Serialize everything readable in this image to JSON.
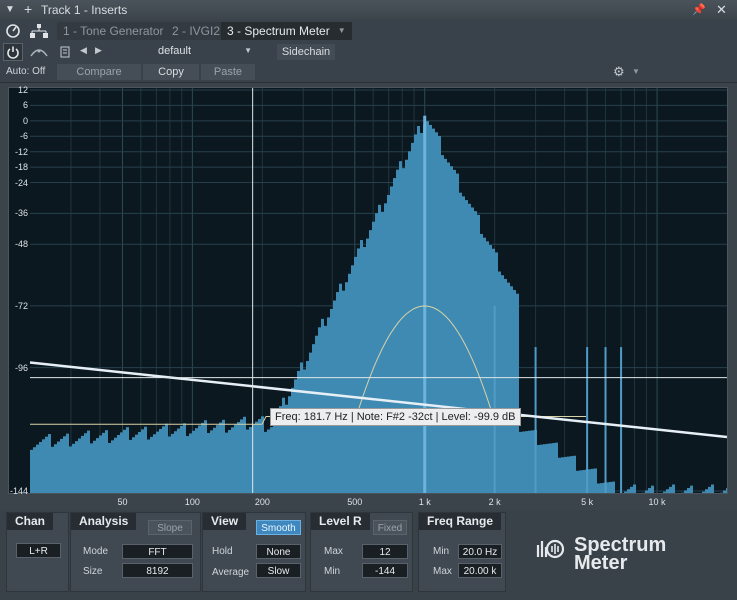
{
  "titlebar": {
    "title": "Track 1 - Inserts"
  },
  "tabs": [
    {
      "label": "1 - Tone Generator"
    },
    {
      "label": "2 - IVGI2"
    },
    {
      "label": "3 - Spectrum Meter"
    }
  ],
  "toolbar": {
    "auto_label": "Auto: Off",
    "preset": "default",
    "sidechain": "Sidechain",
    "compare": "Compare",
    "copy": "Copy",
    "paste": "Paste"
  },
  "tooltip": "Freq: 181.7 Hz | Note: F#2 -32ct | Level: -99.9 dB",
  "chart_data": {
    "type": "area",
    "x_scale": "log",
    "xlim": [
      20,
      20000
    ],
    "ylim": [
      -144,
      12
    ],
    "y_ticks": [
      "12",
      "6",
      "0",
      "-6",
      "-12",
      "-18",
      "-24",
      "-36",
      "-48",
      "-72",
      "-96",
      "-144"
    ],
    "x_ticks": [
      "50",
      "100",
      "200",
      "500",
      "1 k",
      "2 k",
      "5 k",
      "10 k"
    ],
    "cursor": {
      "freq_hz": 181.7,
      "level_db": -99.9
    },
    "slope_line": {
      "x": [
        20,
        20000
      ],
      "y": [
        -94,
        -123
      ]
    },
    "spectrum_peak_hz": 1000,
    "spectrum_peak_db": 2
  },
  "panel": {
    "chan": {
      "title": "Chan",
      "value": "L+R"
    },
    "analysis": {
      "title": "Analysis",
      "slope": "Slope",
      "mode_label": "Mode",
      "mode": "FFT",
      "size_label": "Size",
      "size": "8192"
    },
    "view": {
      "title": "View",
      "smooth": "Smooth",
      "hold_label": "Hold",
      "hold": "None",
      "average_label": "Average",
      "average": "Slow"
    },
    "level": {
      "title": "Level R",
      "fixed": "Fixed",
      "max_label": "Max",
      "max": "12",
      "min_label": "Min",
      "min": "-144"
    },
    "freq": {
      "title": "Freq Range",
      "min_label": "Min",
      "min": "20.0 Hz",
      "max_label": "Max",
      "max": "20.00 k"
    },
    "logo": {
      "line1": "Spectrum",
      "line2": "Meter"
    }
  }
}
